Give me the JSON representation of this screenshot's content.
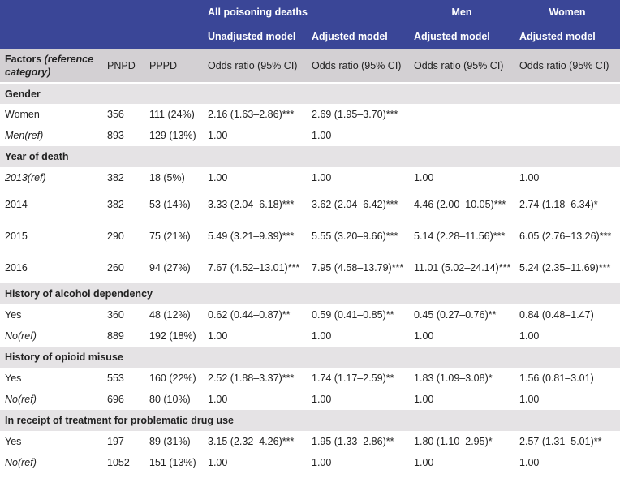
{
  "header": {
    "group_all": "All poisoning deaths",
    "group_men": "Men",
    "group_women": "Women",
    "unadjusted_model": "Unadjusted model",
    "adjusted_model": "Adjusted model",
    "men_adjusted_model": "Adjusted model",
    "women_adjusted_model": "Adjusted model"
  },
  "columns": {
    "factors": "Factors",
    "reference_category": "(reference category)",
    "pnpd": "PNPD",
    "pppd": "PPPD",
    "or1": "Odds ratio (95% CI)",
    "or2": "Odds ratio (95% CI)",
    "or3": "Odds ratio (95% CI)",
    "or4": "Odds ratio (95% CI)"
  },
  "sections": [
    {
      "title": "Gender",
      "rows": [
        {
          "factor": "Women",
          "pnpd": "356",
          "pppd": "111 (24%)",
          "unadj": "2.16 (1.63–2.86)***",
          "adj": "2.69 (1.95–3.70)***",
          "men": "",
          "women": ""
        },
        {
          "factor": "Men(ref)",
          "pnpd": "893",
          "pppd": "129 (13%)",
          "unadj": "1.00",
          "adj": "1.00",
          "men": "",
          "women": ""
        }
      ]
    },
    {
      "title": "Year of death",
      "rows": [
        {
          "factor": "2013(ref)",
          "pnpd": "382",
          "pppd": "18 (5%)",
          "unadj": "1.00",
          "adj": "1.00",
          "men": "1.00",
          "women": "1.00"
        },
        {
          "factor": "2014",
          "pnpd": "382",
          "pppd": "53 (14%)",
          "unadj": "3.33 (2.04–6.18)***",
          "adj": "3.62 (2.04–6.42)***",
          "men": "4.46 (2.00–10.05)***",
          "women": "2.74 (1.18–6.34)*"
        },
        {
          "factor": "2015",
          "pnpd": "290",
          "pppd": "75 (21%)",
          "unadj": "5.49 (3.21–9.39)***",
          "adj": "5.55 (3.20–9.66)***",
          "men": "5.14 (2.28–11.56)***",
          "women": "6.05 (2.76–13.26)***"
        },
        {
          "factor": "2016",
          "pnpd": "260",
          "pppd": "94 (27%)",
          "unadj": "7.67 (4.52–13.01)***",
          "adj": "7.95 (4.58–13.79)***",
          "men": "11.01 (5.02–24.14)***",
          "women": "5.24 (2.35–11.69)***"
        }
      ]
    },
    {
      "title": "History of alcohol dependency",
      "rows": [
        {
          "factor": "Yes",
          "pnpd": "360",
          "pppd": "48 (12%)",
          "unadj": "0.62 (0.44–0.87)**",
          "adj": "0.59 (0.41–0.85)**",
          "men": "0.45 (0.27–0.76)**",
          "women": "0.84 (0.48–1.47)"
        },
        {
          "factor": "No(ref)",
          "pnpd": "889",
          "pppd": "192 (18%)",
          "unadj": "1.00",
          "adj": "1.00",
          "men": "1.00",
          "women": "1.00"
        }
      ]
    },
    {
      "title": "History of opioid misuse",
      "rows": [
        {
          "factor": "Yes",
          "pnpd": "553",
          "pppd": "160 (22%)",
          "unadj": "2.52 (1.88–3.37)***",
          "adj": "1.74 (1.17–2.59)**",
          "men": "1.83 (1.09–3.08)*",
          "women": "1.56 (0.81–3.01)"
        },
        {
          "factor": "No(ref)",
          "pnpd": "696",
          "pppd": "80 (10%)",
          "unadj": "1.00",
          "adj": "1.00",
          "men": "1.00",
          "women": "1.00"
        }
      ]
    },
    {
      "title": "In receipt of treatment for problematic drug use",
      "rows": [
        {
          "factor": "Yes",
          "pnpd": "197",
          "pppd": "89 (31%)",
          "unadj": "3.15 (2.32–4.26)***",
          "adj": "1.95 (1.33–2.86)**",
          "men": "1.80 (1.10–2.95)*",
          "women": "2.57 (1.31–5.01)**"
        },
        {
          "factor": "No(ref)",
          "pnpd": "1052",
          "pppd": "151 (13%)",
          "unadj": "1.00",
          "adj": "1.00",
          "men": "1.00",
          "women": "1.00"
        }
      ]
    }
  ]
}
